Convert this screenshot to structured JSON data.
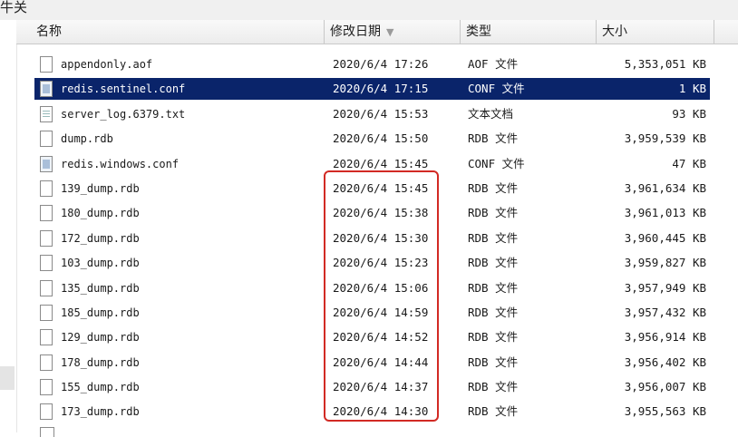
{
  "topbar": {
    "fragment": "牛关"
  },
  "columns": {
    "name": "名称",
    "date": "修改日期",
    "type": "类型",
    "size": "大小"
  },
  "accent": {
    "selection": "#0a246a",
    "highlight": "#d22a24"
  },
  "files": [
    {
      "name": "appendonly.aof",
      "date": "2020/6/4 17:26",
      "type": "AOF 文件",
      "size": "5,353,051 KB",
      "icon": "file-icon"
    },
    {
      "name": "redis.sentinel.conf",
      "date": "2020/6/4 17:15",
      "type": "CONF 文件",
      "size": "1 KB",
      "icon": "conf-file-icon",
      "selected": true
    },
    {
      "name": "server_log.6379.txt",
      "date": "2020/6/4 15:53",
      "type": "文本文档",
      "size": "93 KB",
      "icon": "text-file-icon"
    },
    {
      "name": "dump.rdb",
      "date": "2020/6/4 15:50",
      "type": "RDB 文件",
      "size": "3,959,539 KB",
      "icon": "file-icon"
    },
    {
      "name": "redis.windows.conf",
      "date": "2020/6/4 15:45",
      "type": "CONF 文件",
      "size": "47 KB",
      "icon": "conf-file-icon"
    },
    {
      "name": "139_dump.rdb",
      "date": "2020/6/4 15:45",
      "type": "RDB 文件",
      "size": "3,961,634 KB",
      "icon": "file-icon"
    },
    {
      "name": "180_dump.rdb",
      "date": "2020/6/4 15:38",
      "type": "RDB 文件",
      "size": "3,961,013 KB",
      "icon": "file-icon"
    },
    {
      "name": "172_dump.rdb",
      "date": "2020/6/4 15:30",
      "type": "RDB 文件",
      "size": "3,960,445 KB",
      "icon": "file-icon"
    },
    {
      "name": "103_dump.rdb",
      "date": "2020/6/4 15:23",
      "type": "RDB 文件",
      "size": "3,959,827 KB",
      "icon": "file-icon"
    },
    {
      "name": "135_dump.rdb",
      "date": "2020/6/4 15:06",
      "type": "RDB 文件",
      "size": "3,957,949 KB",
      "icon": "file-icon"
    },
    {
      "name": "185_dump.rdb",
      "date": "2020/6/4 14:59",
      "type": "RDB 文件",
      "size": "3,957,432 KB",
      "icon": "file-icon"
    },
    {
      "name": "129_dump.rdb",
      "date": "2020/6/4 14:52",
      "type": "RDB 文件",
      "size": "3,956,914 KB",
      "icon": "file-icon"
    },
    {
      "name": "178_dump.rdb",
      "date": "2020/6/4 14:44",
      "type": "RDB 文件",
      "size": "3,956,402 KB",
      "icon": "file-icon"
    },
    {
      "name": "155_dump.rdb",
      "date": "2020/6/4 14:37",
      "type": "RDB 文件",
      "size": "3,956,007 KB",
      "icon": "file-icon"
    },
    {
      "name": "173_dump.rdb",
      "date": "2020/6/4 14:30",
      "type": "RDB 文件",
      "size": "3,955,563 KB",
      "icon": "file-icon"
    }
  ]
}
